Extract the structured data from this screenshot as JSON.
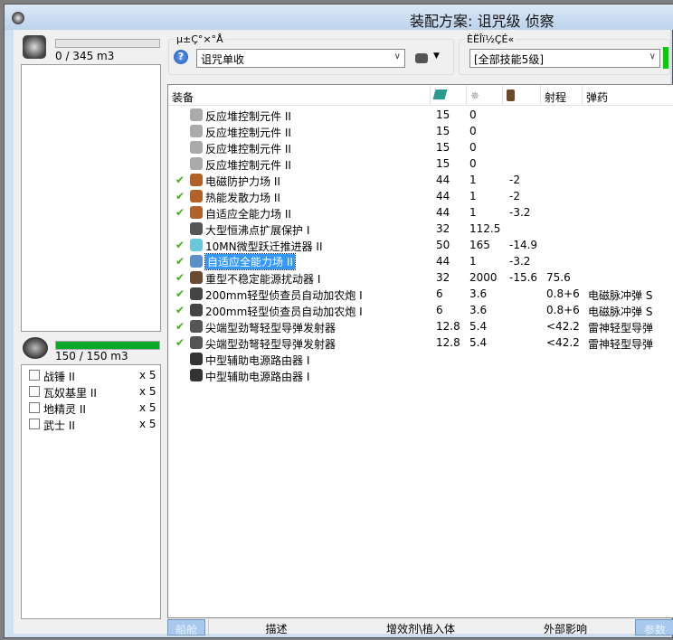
{
  "window": {
    "title": "装配方案: 诅咒级 侦察"
  },
  "cargo": {
    "capacity_text": "0 / 345 m3",
    "fill": 0,
    "items": []
  },
  "drones": {
    "capacity_text": "150 / 150 m3",
    "fill": 1.0,
    "items": [
      {
        "name": "战锤 II",
        "qty": "x 5"
      },
      {
        "name": "瓦奴基里 II",
        "qty": "x 5"
      },
      {
        "name": "地精灵 II",
        "qty": "x 5"
      },
      {
        "name": "武士 II",
        "qty": "x 5"
      }
    ]
  },
  "fitting_group": {
    "label": "µ±Ç°×°Å",
    "selected": "诅咒单收"
  },
  "character_group": {
    "label": "ÈËÎï½ÇÉ«",
    "selected": "[全部技能5级]",
    "status_color": "#00d000"
  },
  "table": {
    "headers": [
      "装备",
      "",
      "",
      "",
      "射程",
      "弹药"
    ],
    "header_icons": [
      "cpu-icon",
      "powergrid-icon",
      "capacitor-icon"
    ],
    "rows": [
      {
        "check": false,
        "icon": "reactor-control-icon",
        "name": "反应堆控制元件 II",
        "c1": "15",
        "c2": "0",
        "c3": "",
        "c4": "",
        "c5": ""
      },
      {
        "check": false,
        "icon": "reactor-control-icon",
        "name": "反应堆控制元件 II",
        "c1": "15",
        "c2": "0",
        "c3": "",
        "c4": "",
        "c5": ""
      },
      {
        "check": false,
        "icon": "reactor-control-icon",
        "name": "反应堆控制元件 II",
        "c1": "15",
        "c2": "0",
        "c3": "",
        "c4": "",
        "c5": ""
      },
      {
        "check": false,
        "icon": "reactor-control-icon",
        "name": "反应堆控制元件 II",
        "c1": "15",
        "c2": "0",
        "c3": "",
        "c4": "",
        "c5": ""
      },
      {
        "check": true,
        "icon": "shield-hardener-icon",
        "name": "电磁防护力场 II",
        "c1": "44",
        "c2": "1",
        "c3": "-2",
        "c4": "",
        "c5": ""
      },
      {
        "check": true,
        "icon": "shield-hardener-icon",
        "name": "热能发散力场 II",
        "c1": "44",
        "c2": "1",
        "c3": "-2",
        "c4": "",
        "c5": ""
      },
      {
        "check": true,
        "icon": "shield-hardener-icon",
        "name": "自适应全能力场 II",
        "c1": "44",
        "c2": "1",
        "c3": "-3.2",
        "c4": "",
        "c5": ""
      },
      {
        "check": false,
        "icon": "shield-extender-icon",
        "name": "大型恒沸点扩展保护 I",
        "c1": "32",
        "c2": "112.5",
        "c3": "",
        "c4": "",
        "c5": ""
      },
      {
        "check": true,
        "icon": "microwarpdrive-icon",
        "name": "10MN微型跃迁推进器 II",
        "c1": "50",
        "c2": "165",
        "c3": "-14.9",
        "c4": "",
        "c5": ""
      },
      {
        "check": true,
        "icon": "shield-hardener-icon",
        "name": "自适应全能力场 II",
        "c1": "44",
        "c2": "1",
        "c3": "-3.2",
        "c4": "",
        "c5": "",
        "selected": true
      },
      {
        "check": true,
        "icon": "energy-neutralizer-icon",
        "name": "重型不稳定能源扰动器 I",
        "c1": "32",
        "c2": "2000",
        "c3": "-15.6",
        "c4": "75.6",
        "c5": ""
      },
      {
        "check": true,
        "icon": "autocannon-icon",
        "name": "200mm轻型侦查员自动加农炮 I",
        "c1": "6",
        "c2": "3.6",
        "c3": "",
        "c4": "0.8+6",
        "c5": "电磁脉冲弹 S"
      },
      {
        "check": true,
        "icon": "autocannon-icon",
        "name": "200mm轻型侦查员自动加农炮 I",
        "c1": "6",
        "c2": "3.6",
        "c3": "",
        "c4": "0.8+6",
        "c5": "电磁脉冲弹 S"
      },
      {
        "check": true,
        "icon": "missile-launcher-icon",
        "name": "尖端型劲弩轻型导弹发射器",
        "c1": "12.8",
        "c2": "5.4",
        "c3": "",
        "c4": "<42.2",
        "c5": "雷神轻型导弹"
      },
      {
        "check": true,
        "icon": "missile-launcher-icon",
        "name": "尖端型劲弩轻型导弹发射器",
        "c1": "12.8",
        "c2": "5.4",
        "c3": "",
        "c4": "<42.2",
        "c5": "雷神轻型导弹"
      },
      {
        "check": false,
        "icon": "power-router-icon",
        "name": "中型辅助电源路由器 I",
        "c1": "",
        "c2": "",
        "c3": "",
        "c4": "",
        "c5": ""
      },
      {
        "check": false,
        "icon": "power-router-icon",
        "name": "中型辅助电源路由器 I",
        "c1": "",
        "c2": "",
        "c3": "",
        "c4": "",
        "c5": ""
      }
    ]
  },
  "tabs": [
    "船舱",
    "描述",
    "增效剂\\植入体",
    "外部影响",
    "参数"
  ],
  "colors": {
    "accent": "#3399ff",
    "check": "#3bb018",
    "progress": "#08a82a"
  }
}
